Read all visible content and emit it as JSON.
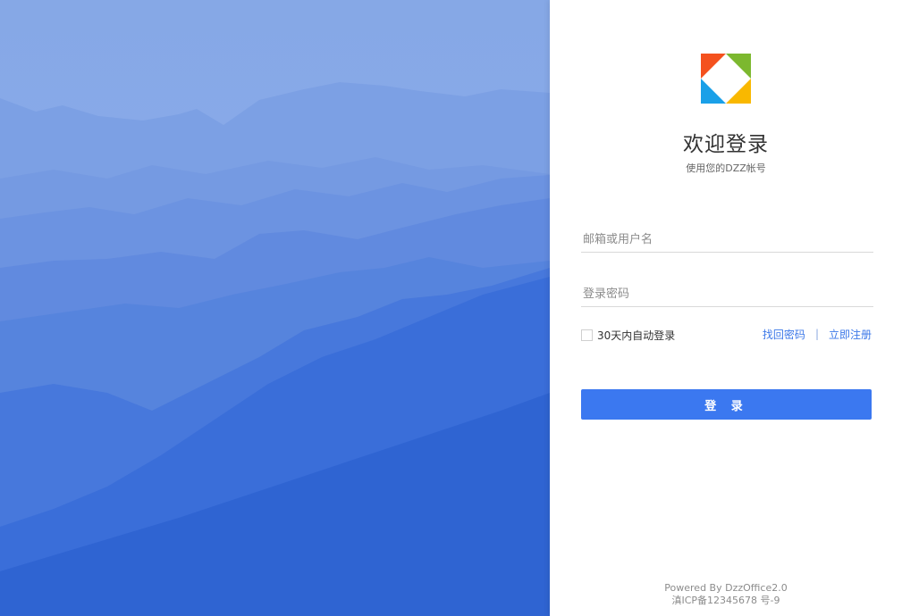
{
  "login": {
    "title": "欢迎登录",
    "subtitle": "使用您的DZZ帐号",
    "username_placeholder": "邮箱或用户名",
    "password_placeholder": "登录密码",
    "remember_label": "30天内自动登录",
    "forgot_link": "找回密码",
    "separator": "|",
    "register_link": "立即注册",
    "submit_label": "登 录"
  },
  "footer": {
    "powered_by": "Powered By DzzOffice2.0",
    "icp": "滇ICP备12345678 号-9"
  },
  "colors": {
    "accent": "#3b78f0",
    "link": "#3c78e8",
    "logo_red": "#f4511e",
    "logo_green": "#7cb82f",
    "logo_blue": "#1aa0e8",
    "logo_yellow": "#f9b800"
  }
}
